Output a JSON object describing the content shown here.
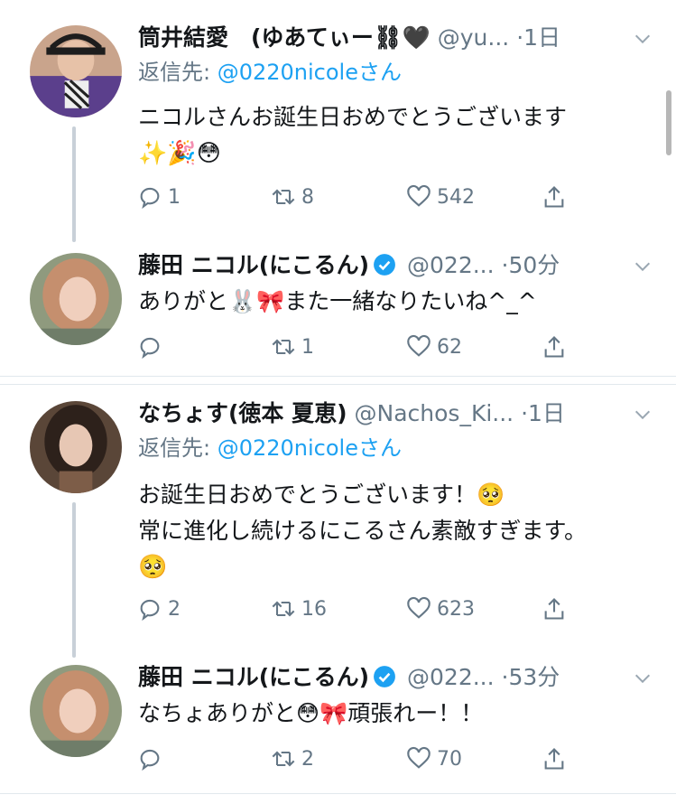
{
  "colors": {
    "link": "#1da1f2",
    "muted": "#657786",
    "text": "#14171a",
    "verified": "#1da1f2",
    "thread_line": "#c8d0d8"
  },
  "tweets": [
    {
      "name": "筒井結愛　(ゆあてぃー⛓🖤",
      "handle": "@yu...",
      "dot": "·",
      "time": "1日",
      "reply_prefix": "返信先: ",
      "reply_mention": "@0220nicoleさん",
      "text_lines": [
        "ニコルさんお誕生日おめでとうございます",
        "✨🎉😳"
      ],
      "reply_count": "1",
      "retweet_count": "8",
      "like_count": "542",
      "avatar_icon": "user-avatar"
    },
    {
      "name": "藤田 ニコル(にこるん)",
      "handle": "@022...",
      "dot": "·",
      "time": "50分",
      "text_lines": [
        "ありがと🐰🎀また一緒なりたいね^_^"
      ],
      "reply_count": "",
      "retweet_count": "1",
      "like_count": "62",
      "avatar_icon": "user-avatar"
    },
    {
      "name": "なちょす(徳本 夏恵)",
      "handle": "@Nachos_Ki...",
      "dot": "·",
      "time": "1日",
      "reply_prefix": "返信先: ",
      "reply_mention": "@0220nicoleさん",
      "text_lines": [
        "お誕生日おめでとうございます！🥺",
        "常に進化し続けるにこるさん素敵すぎます。",
        "🥺"
      ],
      "reply_count": "2",
      "retweet_count": "16",
      "like_count": "623",
      "avatar_icon": "user-avatar"
    },
    {
      "name": "藤田 ニコル(にこるん)",
      "handle": "@022...",
      "dot": "·",
      "time": "53分",
      "text_lines": [
        "なちょありがと😳🎀頑張れー！！"
      ],
      "reply_count": "",
      "retweet_count": "2",
      "like_count": "70",
      "avatar_icon": "user-avatar"
    }
  ]
}
